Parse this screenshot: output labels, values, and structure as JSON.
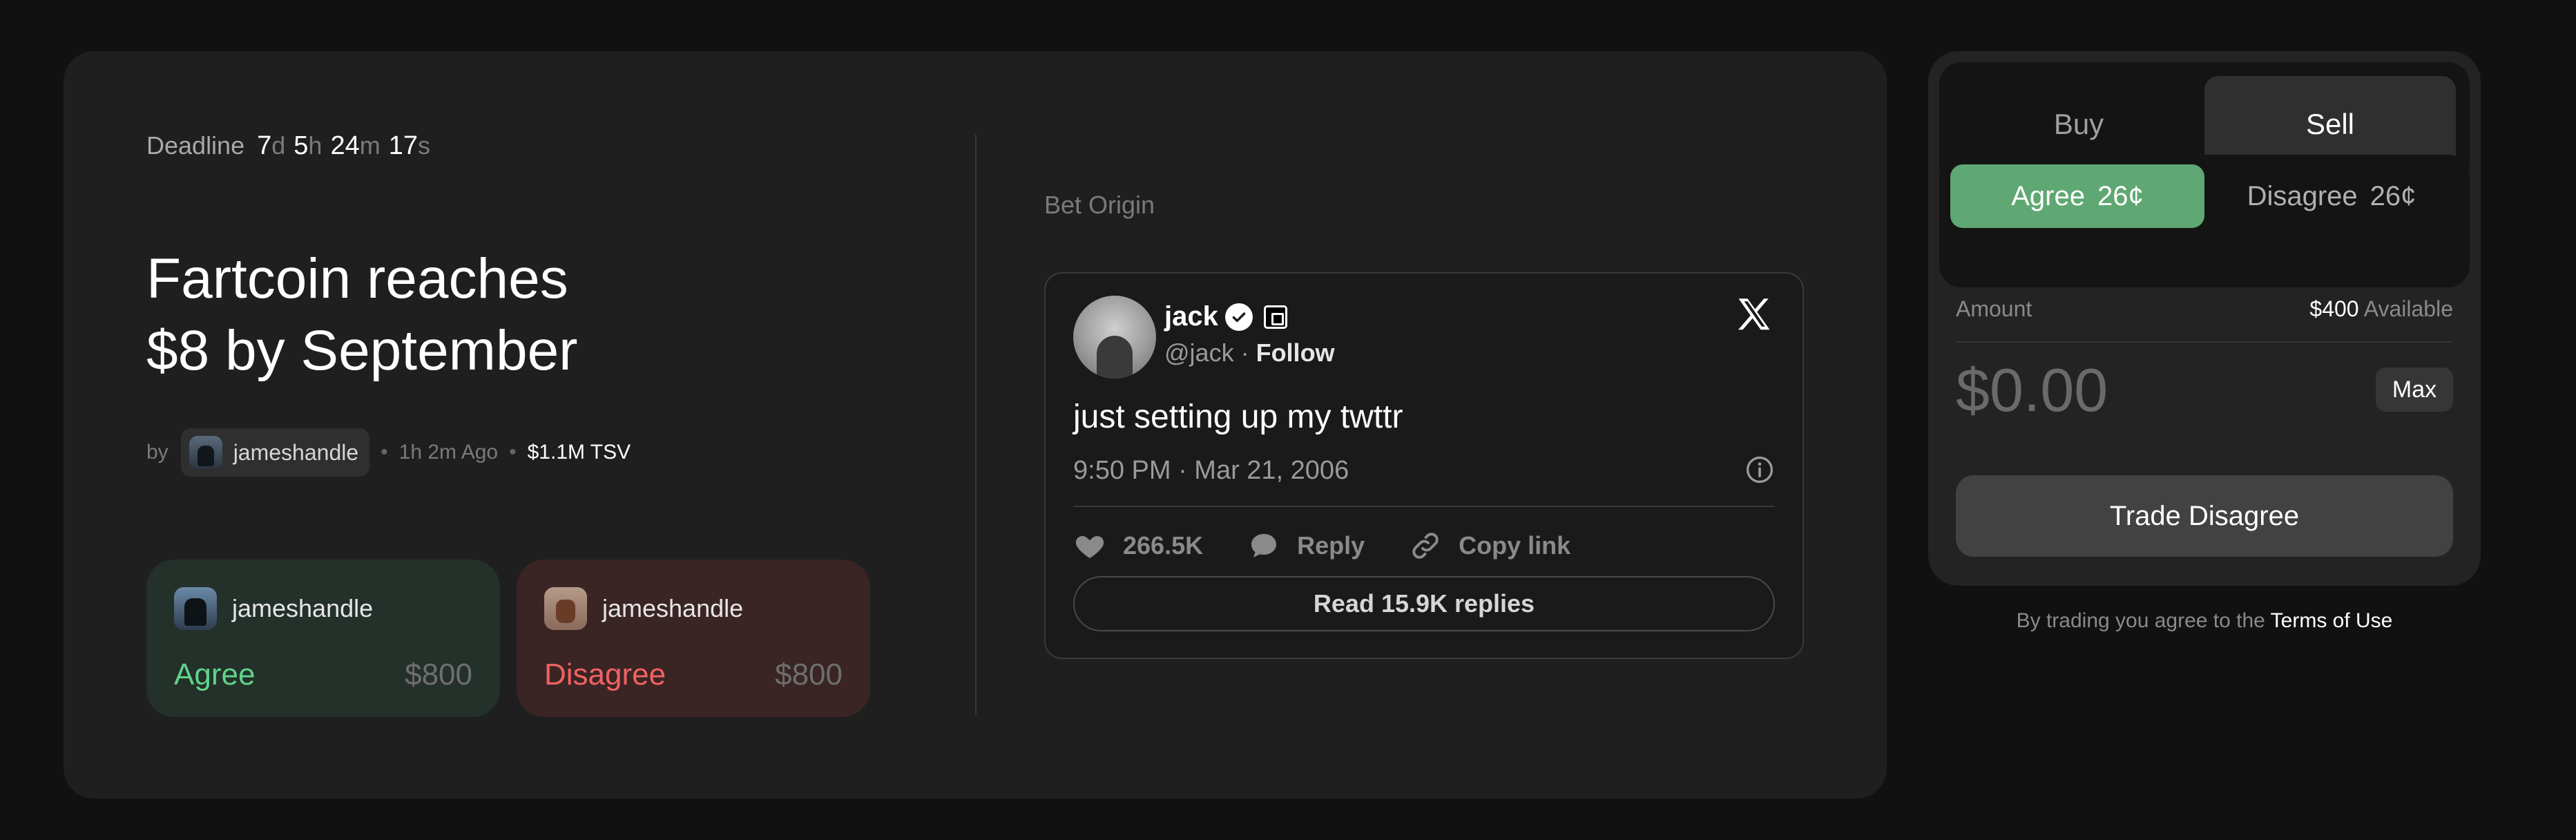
{
  "deadline": {
    "label": "Deadline",
    "days": "7",
    "days_unit": "d",
    "hours": "5",
    "hours_unit": "h",
    "minutes": "24",
    "minutes_unit": "m",
    "seconds": "17",
    "seconds_unit": "s"
  },
  "market": {
    "title_line1": "Fartcoin reaches",
    "title_line2": "$8 by September",
    "by_label": "by",
    "creator": "jameshandle",
    "age": "1h 2m Ago",
    "tsv": "$1.1M TSV"
  },
  "positions": [
    {
      "user": "jameshandle",
      "side": "Agree",
      "amount": "$800"
    },
    {
      "user": "jameshandle",
      "side": "Disagree",
      "amount": "$800"
    }
  ],
  "origin": {
    "label": "Bet Origin",
    "tweet": {
      "name": "jack",
      "handle": "@jack",
      "separator": "·",
      "follow": "Follow",
      "text": "just setting up my twttr",
      "timestamp": "9:50 PM · Mar 21, 2006",
      "likes": "266.5K",
      "reply_label": "Reply",
      "copy_label": "Copy link",
      "read_replies": "Read 15.9K replies"
    }
  },
  "trade": {
    "tab_buy": "Buy",
    "tab_sell": "Sell",
    "agree_label": "Agree",
    "agree_price": "26¢",
    "disagree_label": "Disagree",
    "disagree_price": "26¢",
    "amount_label": "Amount",
    "available_value": "$400",
    "available_label": "Available",
    "amount_placeholder": "$0.00",
    "max_label": "Max",
    "trade_button": "Trade Disagree",
    "terms_prefix": "By trading you agree to the",
    "terms_link": "Terms of Use"
  },
  "colors": {
    "agree": "#5fd38a",
    "disagree": "#f06262",
    "agree_button": "#5fa873"
  }
}
